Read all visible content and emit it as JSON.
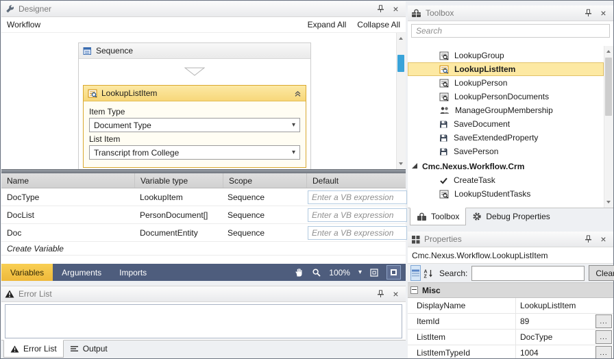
{
  "colors": {
    "selection_yellow": "#fde9a3",
    "activity_header_yellow": "#f7d77a",
    "active_tab_gold": "#f3c245",
    "dark_bar_blue": "#4e5d7d",
    "scroll_thumb_blue": "#39a3d9"
  },
  "icons": {
    "close": "×",
    "caret": "▾",
    "ellipsis": "..."
  },
  "designer": {
    "title": "Designer",
    "breadcrumb": "Workflow",
    "expand_all": "Expand All",
    "collapse_all": "Collapse All",
    "sequence": {
      "title": "Sequence",
      "activity": {
        "title": "LookupListItem",
        "item_type_label": "Item Type",
        "item_type_value": "Document Type",
        "list_item_label": "List Item",
        "list_item_value": "Transcript from College"
      }
    },
    "variables": {
      "columns": [
        "Name",
        "Variable type",
        "Scope",
        "Default"
      ],
      "rows": [
        {
          "name": "DocType",
          "type": "LookupItem",
          "scope": "Sequence",
          "placeholder": "Enter a VB expression"
        },
        {
          "name": "DocList",
          "type": "PersonDocument[]",
          "scope": "Sequence",
          "placeholder": "Enter a VB expression"
        },
        {
          "name": "Doc",
          "type": "DocumentEntity",
          "scope": "Sequence",
          "placeholder": "Enter a VB expression"
        }
      ],
      "create_variable": "Create Variable"
    },
    "bottom_bar": {
      "tabs": [
        "Variables",
        "Arguments",
        "Imports"
      ],
      "zoom": "100%"
    }
  },
  "error_list": {
    "title": "Error List",
    "tabs": [
      "Error List",
      "Output"
    ]
  },
  "toolbox": {
    "title": "Toolbox",
    "search_placeholder": "Search",
    "items": [
      {
        "label": "LookupGroup",
        "icon": "lookup"
      },
      {
        "label": "LookupListItem",
        "icon": "lookup",
        "selected": true
      },
      {
        "label": "LookupPerson",
        "icon": "lookup"
      },
      {
        "label": "LookupPersonDocuments",
        "icon": "lookup"
      },
      {
        "label": "ManageGroupMembership",
        "icon": "people"
      },
      {
        "label": "SaveDocument",
        "icon": "save"
      },
      {
        "label": "SaveExtendedProperty",
        "icon": "save"
      },
      {
        "label": "SavePerson",
        "icon": "save"
      },
      {
        "label": "Cmc.Nexus.Workflow.Crm",
        "icon": "category"
      },
      {
        "label": "CreateTask",
        "icon": "task"
      },
      {
        "label": "LookupStudentTasks",
        "icon": "lookup"
      }
    ],
    "tabs": [
      "Toolbox",
      "Debug Properties"
    ]
  },
  "properties": {
    "title": "Properties",
    "object_name": "Cmc.Nexus.Workflow.LookupListItem",
    "search_label": "Search:",
    "clear_label": "Clear",
    "category": "Misc",
    "rows": [
      {
        "name": "DisplayName",
        "value": "LookupListItem"
      },
      {
        "name": "ItemId",
        "value": "89"
      },
      {
        "name": "ListItem",
        "value": "DocType"
      },
      {
        "name": "ListItemTypeId",
        "value": "1004"
      }
    ]
  }
}
